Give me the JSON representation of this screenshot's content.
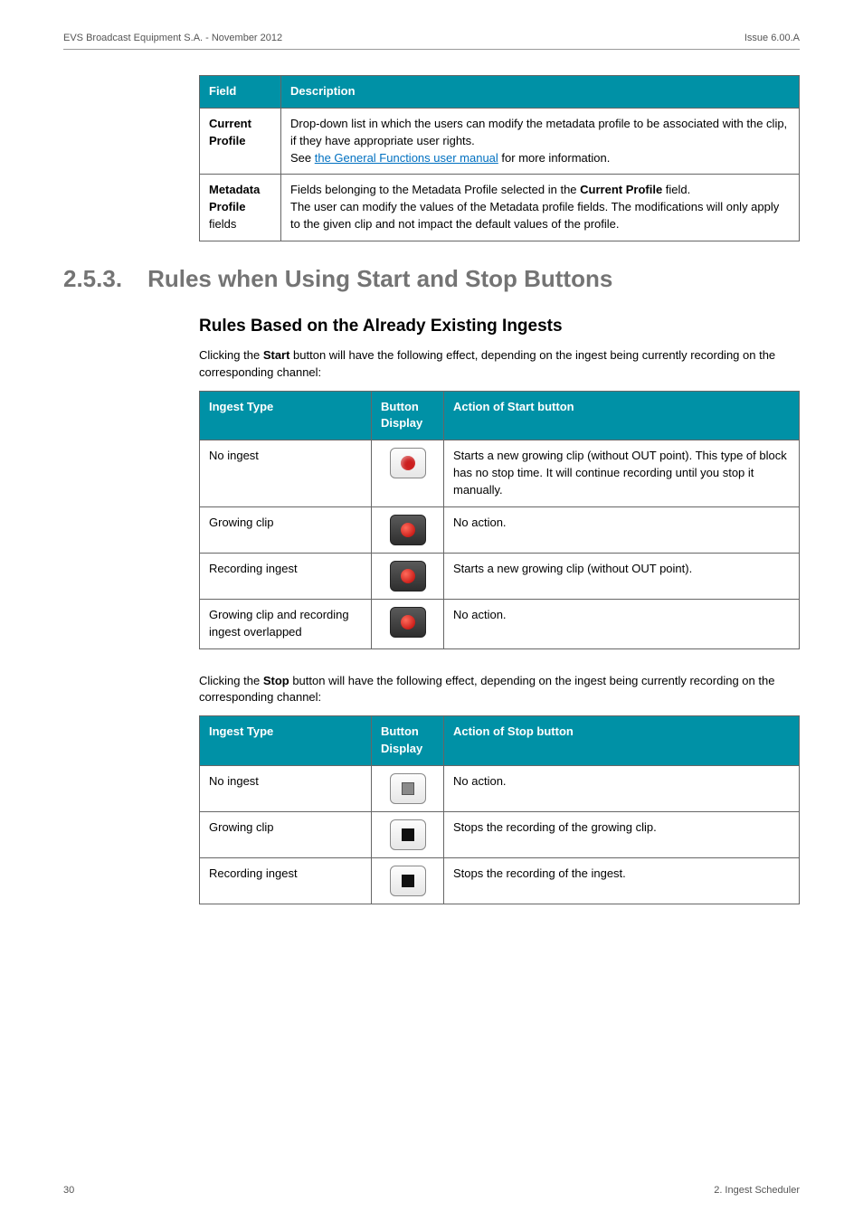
{
  "header": {
    "left": "EVS Broadcast Equipment S.A. - November 2012",
    "right": "Issue 6.00.A"
  },
  "table1": {
    "h1": "Field",
    "h2": "Description",
    "r1c1a": "Current",
    "r1c1b": "Profile",
    "r1c2a": "Drop-down list in which the users can modify the metadata profile to be associated with the clip, if they have appropriate user rights.",
    "r1c2b_pre": "See ",
    "r1c2b_link": "the General Functions user manual",
    "r1c2b_post": " for more information.",
    "r2c1a": "Metadata",
    "r2c1b": "Profile",
    "r2c1c": "fields",
    "r2c2a_pre": "Fields belonging to the Metadata Profile selected in the ",
    "r2c2a_bold": "Current Profile",
    "r2c2a_post": " field.",
    "r2c2b": "The user can modify the values of the Metadata profile fields. The modifications will only apply to the given clip and not impact the default values of the profile."
  },
  "section": {
    "num": "2.5.3.",
    "title": "Rules when Using Start and Stop Buttons"
  },
  "subhead1": "Rules Based on the Already Existing Ingests",
  "para1_pre": "Clicking the ",
  "para1_bold": "Start",
  "para1_post": " button will have the following effect, depending on the ingest being currently recording on the corresponding channel:",
  "table2": {
    "h1": "Ingest Type",
    "h2a": "Button",
    "h2b": "Display",
    "h3": "Action of Start button",
    "r1c1": "No ingest",
    "r1c3": "Starts a new growing clip (without OUT point). This type of block has no stop time. It will continue recording until you stop it manually.",
    "r2c1": "Growing clip",
    "r2c3": "No action.",
    "r3c1": "Recording ingest",
    "r3c3": "Starts a new growing clip (without OUT point).",
    "r4c1": "Growing clip and recording ingest overlapped",
    "r4c3": "No action."
  },
  "para2_pre": "Clicking the ",
  "para2_bold": "Stop",
  "para2_post": " button will have the following effect, depending on the ingest being currently recording on the corresponding channel:",
  "table3": {
    "h1": "Ingest Type",
    "h2a": "Button",
    "h2b": "Display",
    "h3": "Action of Stop button",
    "r1c1": "No ingest",
    "r1c3": "No action.",
    "r2c1": "Growing clip",
    "r2c3": "Stops the recording of the growing clip.",
    "r3c1": "Recording ingest",
    "r3c3": "Stops the recording of the ingest."
  },
  "footer": {
    "left": "30",
    "right": "2. Ingest Scheduler"
  }
}
